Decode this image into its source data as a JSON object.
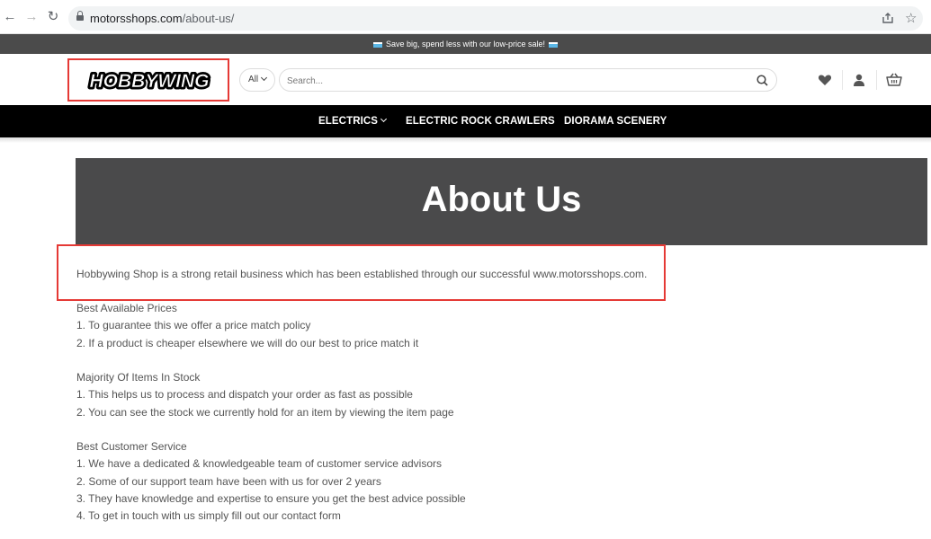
{
  "browser": {
    "url_domain": "motorsshops.com",
    "url_path": "/about-us/"
  },
  "promo": {
    "text": "Save big, spend less with our low-price sale!"
  },
  "header": {
    "logo_text": "HOBBYWING",
    "category_label": "All",
    "search_placeholder": "Search..."
  },
  "nav": {
    "items": [
      {
        "label": "ELECTRICS"
      },
      {
        "label": "ELECTRIC ROCK CRAWLERS"
      },
      {
        "label": "DIORAMA SCENERY"
      }
    ]
  },
  "hero": {
    "title": "About Us"
  },
  "content": {
    "intro": "Hobbywing Shop is a strong retail business which has been established through our successful www.motorsshops.com.",
    "sections": [
      {
        "heading": "Best Available Prices",
        "items": [
          "1. To guarantee this we offer a price match policy",
          "2. If a product is cheaper elsewhere we will do our best to price match it"
        ]
      },
      {
        "heading": "Majority Of Items In Stock",
        "items": [
          "1. This helps us to process and dispatch your order as fast as possible",
          "2. You can see the stock we currently hold for an item by viewing the item page"
        ]
      },
      {
        "heading": "Best Customer Service",
        "items": [
          "1. We have a dedicated & knowledgeable team of customer service advisors",
          "2. Some of our support team have been with us for over 2 years",
          "3. They have knowledge and expertise to ensure you get the best advice possible",
          "4. To get in touch with us simply fill out our contact form"
        ]
      }
    ]
  },
  "colors": {
    "highlight": "#e53935",
    "hero_bg": "#4a4a4b",
    "nav_bg": "#000000",
    "promo_bg": "#4b4b4b"
  }
}
